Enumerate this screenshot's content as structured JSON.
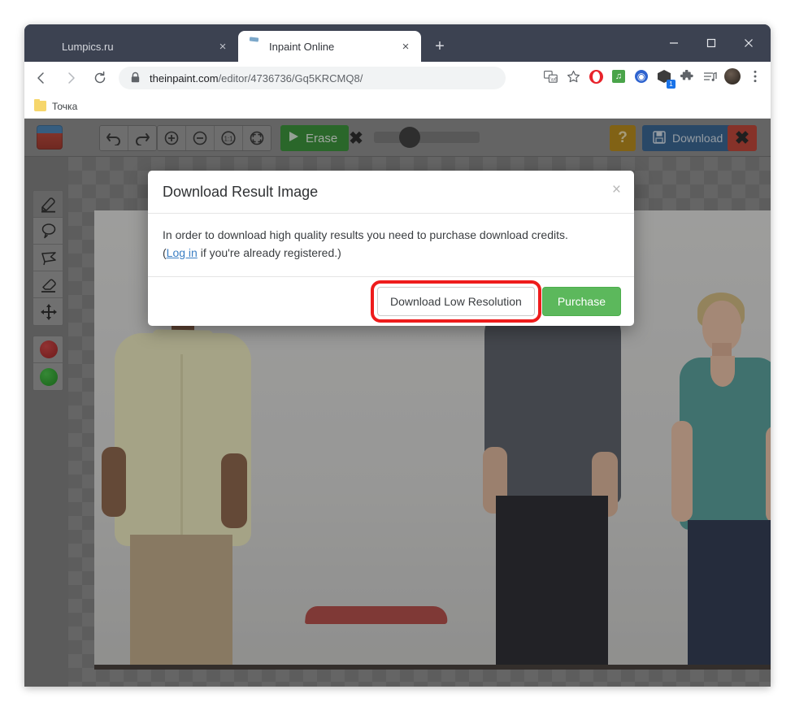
{
  "browser": {
    "tabs": [
      {
        "title": "Lumpics.ru",
        "favicon": "orange-circle-icon",
        "active": false,
        "close_label": "×"
      },
      {
        "title": "Inpaint Online",
        "favicon": "inpaint-icon",
        "active": true,
        "close_label": "×"
      }
    ],
    "new_tab_label": "+",
    "window_controls": {
      "minimize": "—",
      "maximize": "□",
      "close": "✕"
    },
    "nav": {
      "back": "←",
      "forward": "→",
      "reload": "↻"
    },
    "omnibox": {
      "url_host": "theinpaint.com",
      "url_path": "/editor/4736736/Gq5KRCMQ8/",
      "lock_icon": "padlock-icon"
    },
    "extension_icons": [
      "translate-icon",
      "bookmark-star-icon",
      "opera-icon",
      "music-icon",
      "globe-icon",
      "box-icon",
      "puzzle-extensions-icon",
      "playlist-icon",
      "profile-avatar-icon",
      "chrome-menu-icon"
    ],
    "box_badge": "1",
    "bookmarks": [
      {
        "label": "Точка",
        "icon": "folder-icon"
      }
    ]
  },
  "editor": {
    "logo_alt": "inpaint-logo",
    "history_buttons": [
      {
        "name": "undo-button",
        "glyph": "↶"
      },
      {
        "name": "redo-button",
        "glyph": "↷"
      }
    ],
    "zoom_buttons": [
      {
        "name": "zoom-in-button",
        "glyph": "+"
      },
      {
        "name": "zoom-out-button",
        "glyph": "−"
      },
      {
        "name": "zoom-actual-size-button",
        "glyph": "1:1"
      },
      {
        "name": "zoom-fit-button",
        "glyph": "⛶"
      }
    ],
    "erase_button": {
      "label": "Erase",
      "icon": "play-triangle-icon",
      "color": "#2d8e2d"
    },
    "clear_selection_button": {
      "name": "clear-selection-button",
      "glyph": "✖"
    },
    "brush_size_slider": {
      "name": "brush-size-slider",
      "value_position_pct": 25
    },
    "help_button": {
      "label": "?",
      "color": "#b8860b"
    },
    "download_button": {
      "label": "Download",
      "icon": "floppy-disk-icon",
      "color": "#2a5d8f"
    },
    "close_button": {
      "glyph": "✖",
      "color": "#c0392b"
    },
    "tools": [
      {
        "name": "marker-tool",
        "glyph": "marker-icon",
        "selected": true
      },
      {
        "name": "lasso-tool",
        "glyph": "lasso-icon",
        "selected": false
      },
      {
        "name": "polygon-lasso-tool",
        "glyph": "polygon-lasso-icon",
        "selected": false
      },
      {
        "name": "eraser-tool",
        "glyph": "eraser-icon",
        "selected": false
      },
      {
        "name": "move-tool",
        "glyph": "move-arrows-icon",
        "selected": false
      }
    ],
    "color_swatches": [
      {
        "name": "red-swatch",
        "color": "#c02020"
      },
      {
        "name": "green-swatch",
        "color": "#1fa81f"
      }
    ]
  },
  "modal": {
    "title": "Download Result Image",
    "close_label": "×",
    "body_line1": "In order to download high quality results you need to purchase download credits.",
    "body_prefix": "(",
    "body_link": "Log in",
    "body_suffix": " if you're already registered.)",
    "buttons": {
      "download_low": "Download Low Resolution",
      "purchase": "Purchase"
    },
    "highlight_color": "#ee1c1c"
  }
}
